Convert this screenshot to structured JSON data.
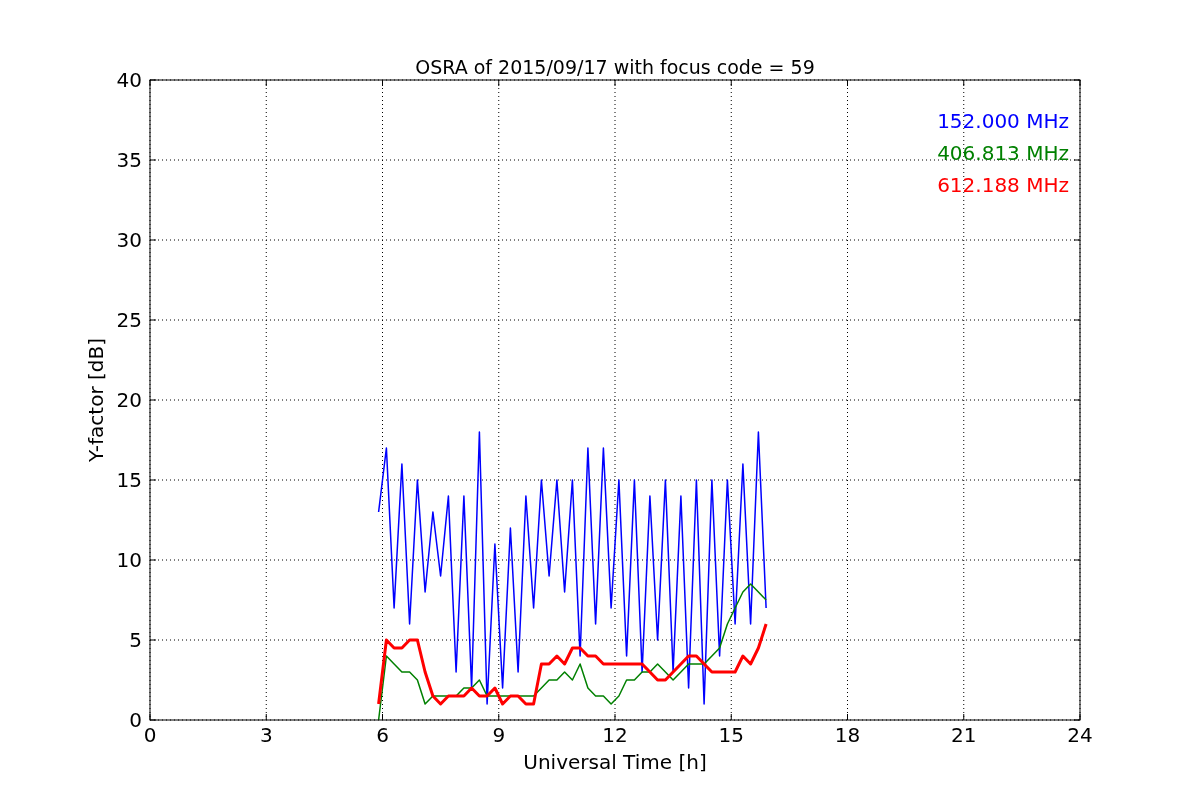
{
  "chart_data": {
    "type": "line",
    "title": "OSRA of 2015/09/17 with focus code = 59",
    "xlabel": "Universal Time [h]",
    "ylabel": "Y-factor [dB]",
    "grid": true,
    "xlim": [
      0,
      24
    ],
    "ylim": [
      0,
      40
    ],
    "xticks": [
      0,
      3,
      6,
      9,
      12,
      15,
      18,
      21,
      24
    ],
    "yticks": [
      0,
      5,
      10,
      15,
      20,
      25,
      30,
      35,
      40
    ],
    "x": [
      5.9,
      6.1,
      6.3,
      6.5,
      6.7,
      6.9,
      7.1,
      7.3,
      7.5,
      7.7,
      7.9,
      8.1,
      8.3,
      8.5,
      8.7,
      8.9,
      9.1,
      9.3,
      9.5,
      9.7,
      9.9,
      10.1,
      10.3,
      10.5,
      10.7,
      10.9,
      11.1,
      11.3,
      11.5,
      11.7,
      11.9,
      12.1,
      12.3,
      12.5,
      12.7,
      12.9,
      13.1,
      13.3,
      13.5,
      13.7,
      13.9,
      14.1,
      14.3,
      14.5,
      14.7,
      14.9,
      15.1,
      15.3,
      15.5,
      15.7,
      15.9
    ],
    "series": [
      {
        "name": "152.000 MHz",
        "color": "#0000ff",
        "values": [
          13,
          17,
          7,
          16,
          6,
          15,
          8,
          13,
          9,
          14,
          3,
          14,
          2,
          18,
          1,
          11,
          2,
          12,
          3,
          14,
          7,
          15,
          9,
          15,
          8,
          15,
          4,
          17,
          6,
          17,
          7,
          15,
          4,
          15,
          3,
          14,
          5,
          15,
          3,
          14,
          2,
          15,
          1,
          15,
          4,
          15,
          6,
          16,
          6,
          18,
          7
        ]
      },
      {
        "name": "406.813 MHz",
        "color": "#008000",
        "values": [
          0,
          4,
          3.5,
          3,
          3,
          2.5,
          1,
          1.5,
          1.5,
          1.5,
          1.5,
          2,
          2,
          2.5,
          1.5,
          1.5,
          1.5,
          1.5,
          1.5,
          1.5,
          1.5,
          2,
          2.5,
          2.5,
          3,
          2.5,
          3.5,
          2,
          1.5,
          1.5,
          1,
          1.5,
          2.5,
          2.5,
          3,
          3,
          3.5,
          3,
          2.5,
          3,
          3.5,
          3.5,
          3.5,
          4,
          4.5,
          6,
          7,
          8,
          8.5,
          8,
          7.5
        ]
      },
      {
        "name": "612.188 MHz",
        "color": "#ff0000",
        "values": [
          1,
          5,
          4.5,
          4.5,
          5,
          5,
          3,
          1.5,
          1,
          1.5,
          1.5,
          1.5,
          2,
          1.5,
          1.5,
          2,
          1,
          1.5,
          1.5,
          1,
          1,
          3.5,
          3.5,
          4,
          3.5,
          4.5,
          4.5,
          4,
          4,
          3.5,
          3.5,
          3.5,
          3.5,
          3.5,
          3.5,
          3,
          2.5,
          2.5,
          3,
          3.5,
          4,
          4,
          3.5,
          3,
          3,
          3,
          3,
          4,
          3.5,
          4.5,
          6
        ]
      }
    ]
  }
}
